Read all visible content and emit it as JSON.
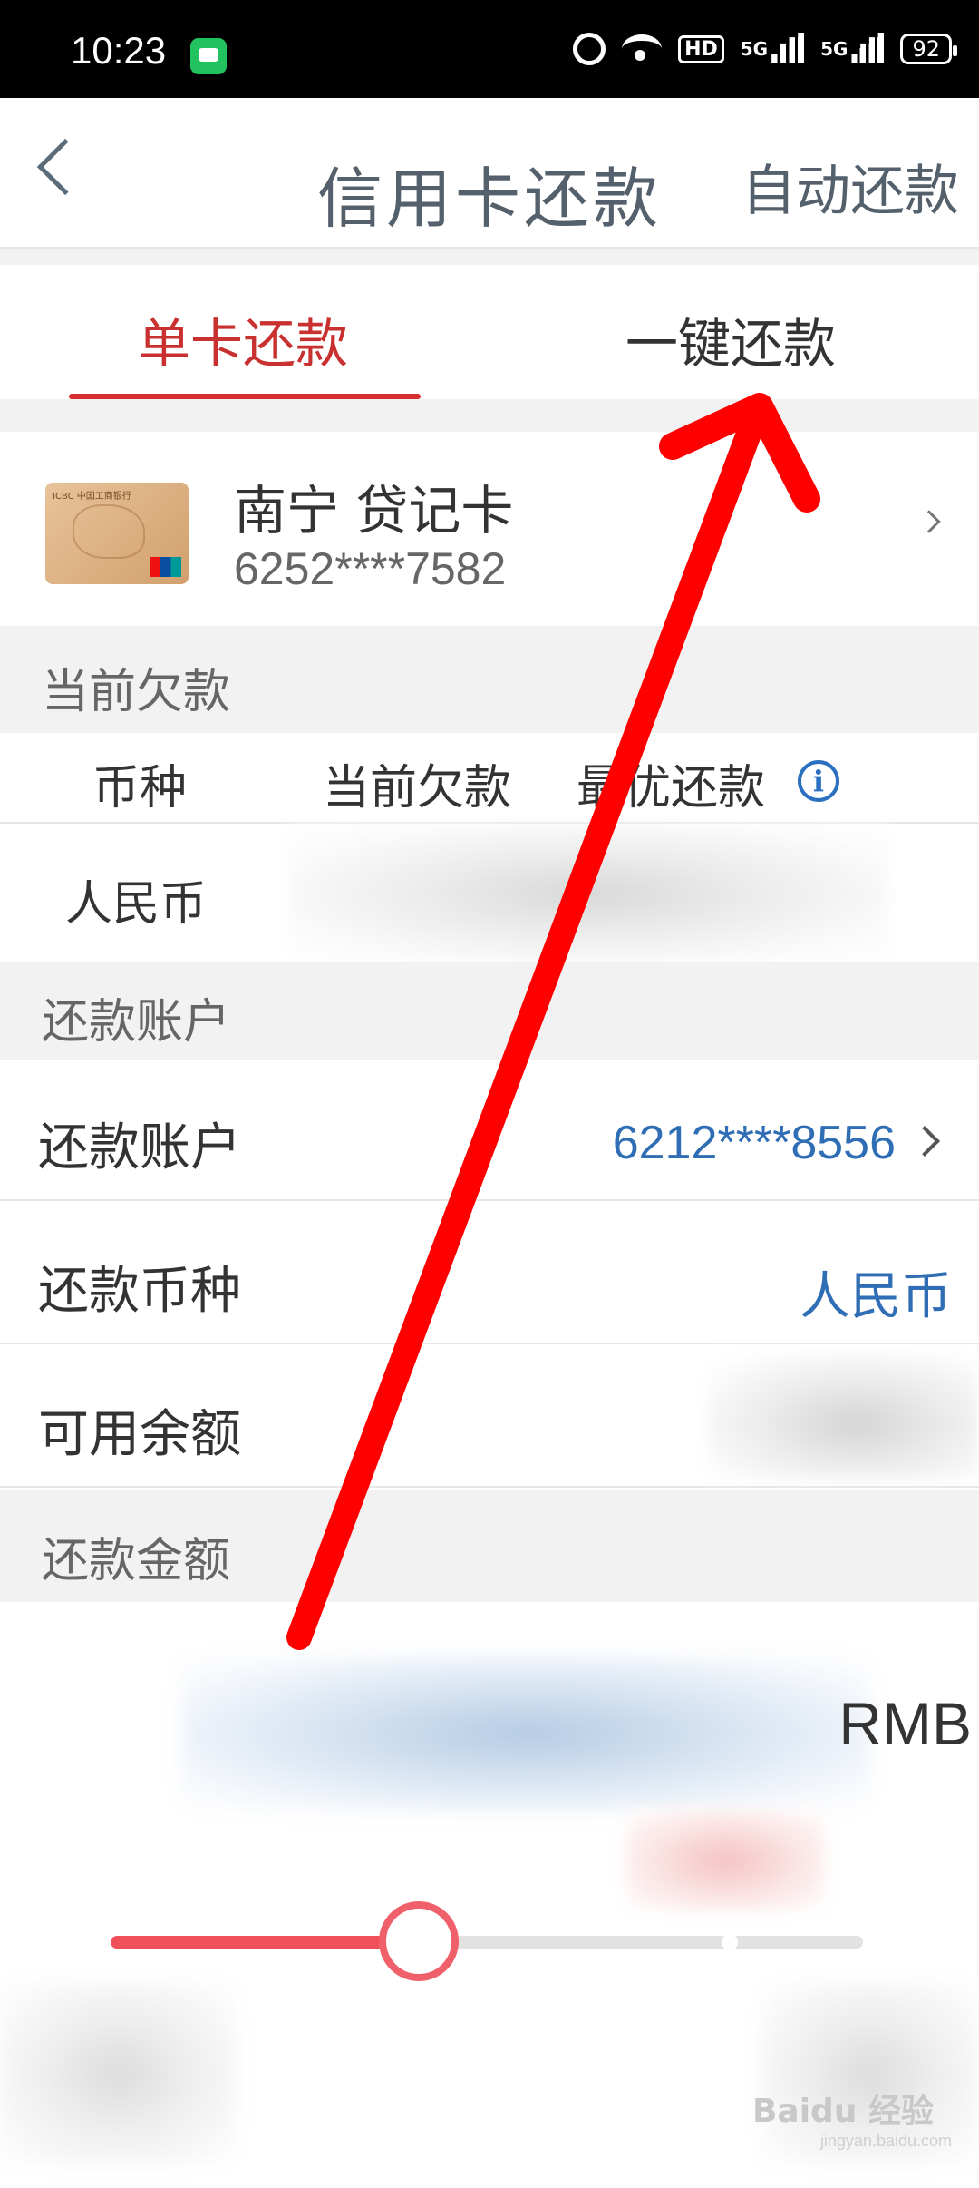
{
  "status_bar": {
    "time": "10:23",
    "battery": "92",
    "hd": "HD",
    "network": "5G"
  },
  "header": {
    "title": "信用卡还款",
    "auto_repay": "自动还款"
  },
  "tabs": [
    {
      "label": "单卡还款",
      "active": true
    },
    {
      "label": "一键还款",
      "active": false
    }
  ],
  "card": {
    "name": "南宁 贷记卡",
    "number": "6252****7582",
    "bank_mini_label": "ICBC 中国工商银行"
  },
  "debt_section": {
    "title": "当前欠款",
    "columns": [
      "币种",
      "当前欠款",
      "最优还款"
    ],
    "row_currency": "人民币"
  },
  "repay_account_section": {
    "title": "还款账户",
    "account_label": "还款账户",
    "account_value": "6212****8556",
    "currency_label": "还款币种",
    "currency_value": "人民币",
    "balance_label": "可用余额"
  },
  "amount_section": {
    "title": "还款金额",
    "unit": "RMB"
  },
  "slider": {
    "value_fraction": 0.41
  },
  "watermark": {
    "brand": "Baidu 经验",
    "url": "jingyan.baidu.com"
  },
  "colors": {
    "accent_red": "#d62e2e",
    "link_blue": "#2f6db5",
    "arrow_red": "#ff0000"
  }
}
